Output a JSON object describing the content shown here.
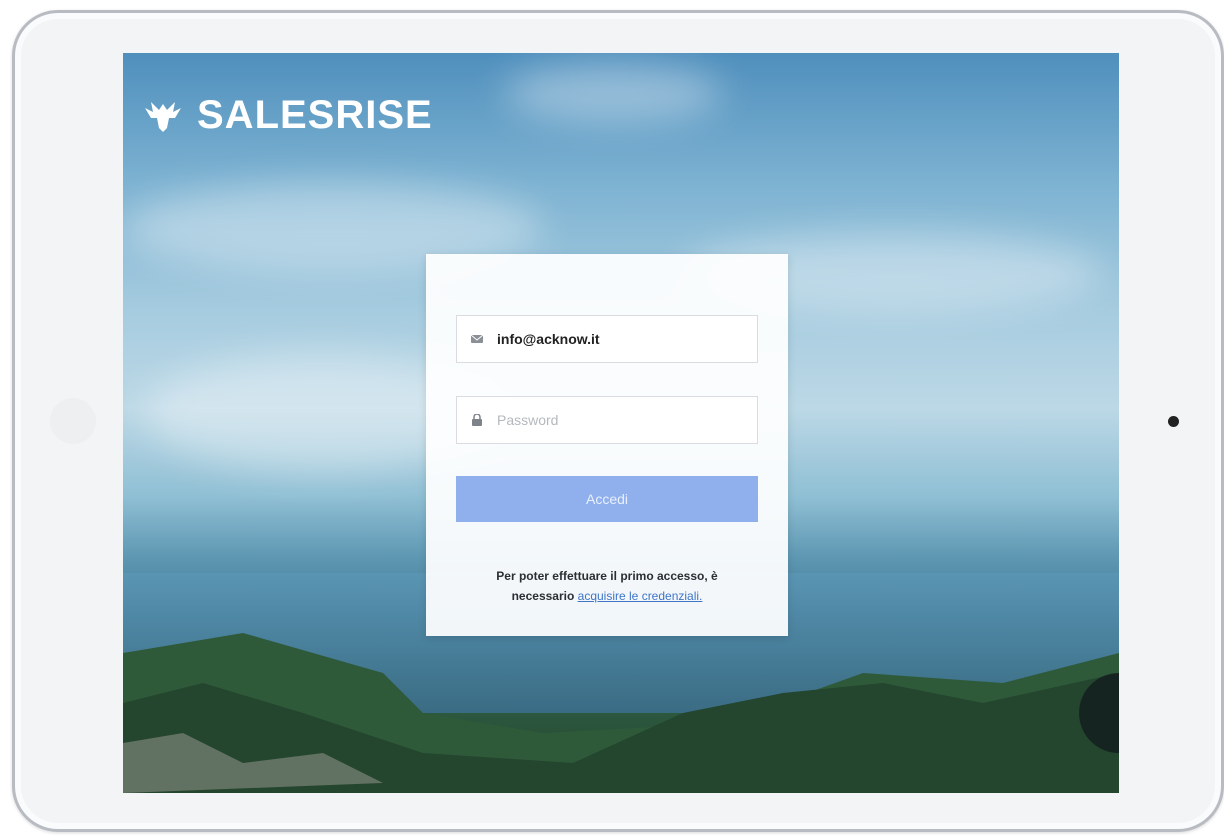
{
  "brand": {
    "name": "SALESRISE",
    "icon": "eagle-logo-icon"
  },
  "login": {
    "email_value": "info@acknow.it",
    "email_icon": "envelope-icon",
    "password_placeholder": "Password",
    "password_icon": "lock-icon",
    "submit_label": "Accedi",
    "info_text_1": "Per poter effettuare il primo accesso, è",
    "info_text_2": "necessario",
    "info_link": "acquisire le credenziali."
  },
  "colors": {
    "button": "#8fb0ec",
    "link": "#3f75c8",
    "card": "#ffffff"
  }
}
